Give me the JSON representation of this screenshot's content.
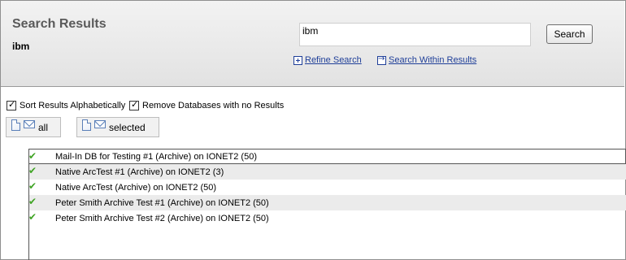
{
  "header": {
    "title": "Search Results",
    "query_display": "ibm",
    "search_value": "ibm",
    "search_button_label": "Search",
    "refine_label": "Refine Search",
    "within_label": "Search Within Results"
  },
  "options": {
    "sort_alpha_label": "Sort Results Alphabetically",
    "sort_alpha_checked": true,
    "remove_empty_label": "Remove Databases with no Results",
    "remove_empty_checked": true
  },
  "actions": {
    "all_label": "all",
    "selected_label": "selected"
  },
  "results": [
    {
      "label": "Mail-In DB for Testing #1 (Archive) on IONET2 (50)",
      "status_icon": "check-icon"
    },
    {
      "label": "Native ArcTest #1 (Archive) on IONET2 (3)",
      "status_icon": "check-icon"
    },
    {
      "label": "Native ArcTest (Archive) on IONET2 (50)",
      "status_icon": "check-icon"
    },
    {
      "label": "Peter Smith Archive Test #1 (Archive) on IONET2 (50)",
      "status_icon": "check-icon"
    },
    {
      "label": "Peter Smith Archive Test #2 (Archive) on IONET2 (50)",
      "status_icon": "check-icon"
    }
  ],
  "colors": {
    "link": "#1f3f99",
    "check": "#3fa324",
    "row_alt": "#ebebeb"
  }
}
